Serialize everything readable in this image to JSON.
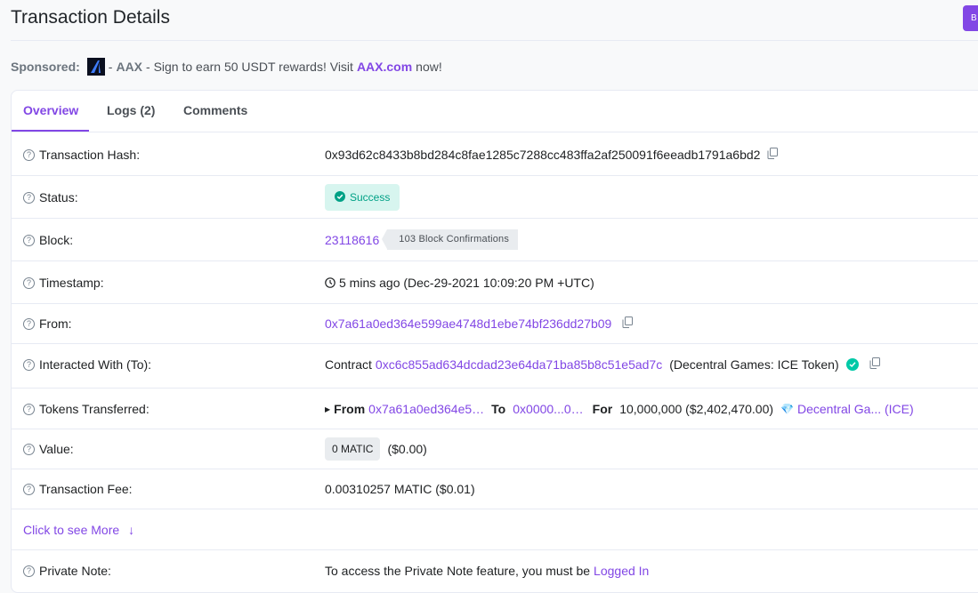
{
  "page": {
    "title": "Transaction Details",
    "top_button_label": "B"
  },
  "sponsored": {
    "label": "Sponsored:",
    "dash1": "-",
    "brand": "AAX",
    "text": "- Sign to earn 50 USDT rewards! Visit",
    "link": "AAX.com",
    "suffix": "now!"
  },
  "tabs": [
    {
      "label": "Overview",
      "active": true
    },
    {
      "label": "Logs (2)",
      "active": false
    },
    {
      "label": "Comments",
      "active": false
    }
  ],
  "rows": {
    "hash": {
      "label": "Transaction Hash:",
      "value": "0x93d62c8433b8bd284c8fae1285c7288cc483ffa2af250091f6eeadb1791a6bd2"
    },
    "status": {
      "label": "Status:",
      "value": "Success"
    },
    "block": {
      "label": "Block:",
      "value": "23118616",
      "confirmations": "103 Block Confirmations"
    },
    "timestamp": {
      "label": "Timestamp:",
      "value": "5 mins ago (Dec-29-2021 10:09:20 PM +UTC)"
    },
    "from": {
      "label": "From:",
      "value": "0x7a61a0ed364e599ae4748d1ebe74bf236dd27b09"
    },
    "to": {
      "label": "Interacted With (To):",
      "prefix": "Contract",
      "address": "0xc6c855ad634dcdad23e64da71ba85b8c51e5ad7c",
      "name": "(Decentral Games: ICE Token)"
    },
    "tokens": {
      "label": "Tokens Transferred:",
      "from_label": "From",
      "from": "0x7a61a0ed364e5…",
      "to_label": "To",
      "to": "0x0000...0…",
      "for_label": "For",
      "amount": "10,000,000 ($2,402,470.00)",
      "token_icon": "💎",
      "token": "Decentral Ga... (ICE)"
    },
    "value": {
      "label": "Value:",
      "badge": "0 MATIC",
      "usd": "($0.00)"
    },
    "fee": {
      "label": "Transaction Fee:",
      "value": "0.00310257 MATIC ($0.01)"
    },
    "more": {
      "label": "Click to see More",
      "icon": "↓"
    },
    "note": {
      "label": "Private Note:",
      "text": "To access the Private Note feature, you must be",
      "link": "Logged In"
    }
  },
  "colors": {
    "accent": "#8247e5",
    "success": "#00a186",
    "success_bg": "#d7f5ef"
  },
  "icons": {
    "help": "?",
    "clock": "clock-icon",
    "copy": "copy-icon"
  }
}
